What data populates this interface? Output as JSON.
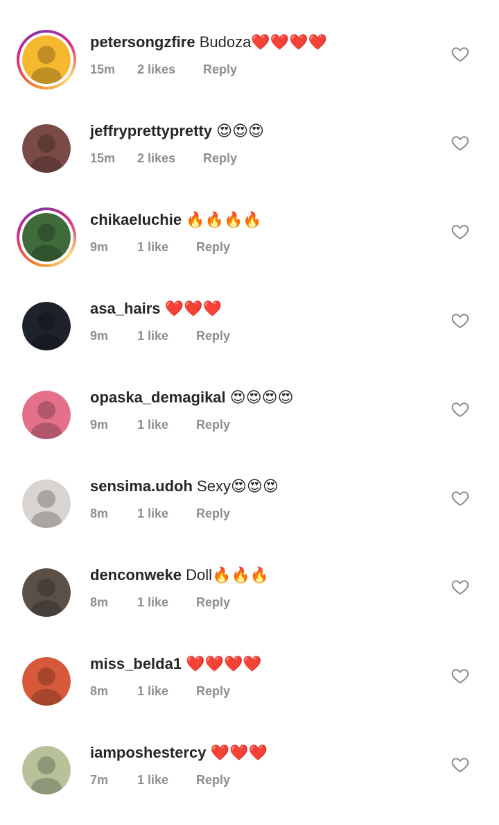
{
  "comments": [
    {
      "username": "petersongzfire",
      "text": "Budoza",
      "emoji": "❤️❤️❤️❤️",
      "emoji_gap": false,
      "time": "15m",
      "likes": "2 likes",
      "reply": "Reply",
      "story_ring": true,
      "avatar_color": "#f5b82e"
    },
    {
      "username": "jeffryprettypretty",
      "text": "",
      "emoji": "😍😍😍",
      "time": "15m",
      "likes": "2 likes",
      "reply": "Reply",
      "story_ring": false,
      "avatar_color": "#7a4a46"
    },
    {
      "username": "chikaeluchie",
      "text": "",
      "emoji": "🔥🔥🔥🔥",
      "time": "9m",
      "likes": "1 like",
      "reply": "Reply",
      "story_ring": true,
      "avatar_color": "#3f6b3a"
    },
    {
      "username": "asa_hairs",
      "text": "",
      "emoji": "❤️❤️❤️",
      "time": "9m",
      "likes": "1 like",
      "reply": "Reply",
      "story_ring": false,
      "avatar_color": "#1e232b"
    },
    {
      "username": "opaska_demagikal",
      "text": "",
      "emoji": "😍😍😍😍",
      "time": "9m",
      "likes": "1 like",
      "reply": "Reply",
      "story_ring": false,
      "avatar_color": "#e5708a"
    },
    {
      "username": "sensima.udoh",
      "text": "Sexy",
      "emoji": "😍😍😍",
      "time": "8m",
      "likes": "1 like",
      "reply": "Reply",
      "story_ring": false,
      "avatar_color": "#d9d4cf"
    },
    {
      "username": "denconweke",
      "text": "Doll",
      "emoji": "🔥🔥🔥",
      "time": "8m",
      "likes": "1 like",
      "reply": "Reply",
      "story_ring": false,
      "avatar_color": "#5a5048"
    },
    {
      "username": "miss_belda1",
      "text": "",
      "emoji": "❤️❤️❤️❤️",
      "time": "8m",
      "likes": "1 like",
      "reply": "Reply",
      "story_ring": false,
      "avatar_color": "#d65a3a"
    },
    {
      "username": "iamposhestercy",
      "text": "",
      "emoji": "❤️❤️❤️",
      "time": "7m",
      "likes": "1 like",
      "reply": "Reply",
      "story_ring": false,
      "avatar_color": "#b7c29a"
    }
  ],
  "icons": {
    "like": "heart-outline-icon"
  },
  "colors": {
    "text": "#262626",
    "meta": "#8e8e8e"
  }
}
